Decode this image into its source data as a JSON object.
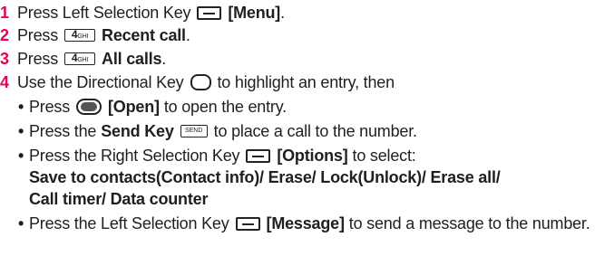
{
  "steps": [
    {
      "num": "1",
      "pre": "Press Left Selection Key",
      "icon": "left-selection-key-icon",
      "bold": "[Menu]",
      "post": "."
    },
    {
      "num": "2",
      "pre": "Press",
      "icon": "number-4-key-icon",
      "icon_label_big": "4",
      "icon_label_small": "GHI",
      "bold": "Recent call",
      "post": "."
    },
    {
      "num": "3",
      "pre": "Press",
      "icon": "number-4-key-icon",
      "icon_label_big": "4",
      "icon_label_small": "GHI",
      "bold": "All calls",
      "post": "."
    },
    {
      "num": "4",
      "pre": "Use the Directional Key",
      "icon": "directional-key-icon",
      "post": "to highlight an entry, then"
    }
  ],
  "bullets": [
    {
      "pre": "Press",
      "icon": "ok-key-icon",
      "bold": "[Open]",
      "post": "to open the entry."
    },
    {
      "pre": "Press the",
      "bold_key": "Send Key",
      "icon": "send-key-icon",
      "icon_label": "SEND",
      "post": "to place a call to the number."
    },
    {
      "pre": "Press the Right Selection Key",
      "icon": "right-selection-key-icon",
      "bold": "[Options]",
      "post": "to select:",
      "options_line1": "Save to contacts(Contact info)/ Erase/ Lock(Unlock)/ Erase all/",
      "options_line2": "Call timer/ Data counter"
    },
    {
      "pre": "Press the Left Selection Key",
      "icon": "left-selection-key-icon",
      "bold": "[Message]",
      "post": "to send a message to the number."
    }
  ],
  "bullet_char": "•"
}
